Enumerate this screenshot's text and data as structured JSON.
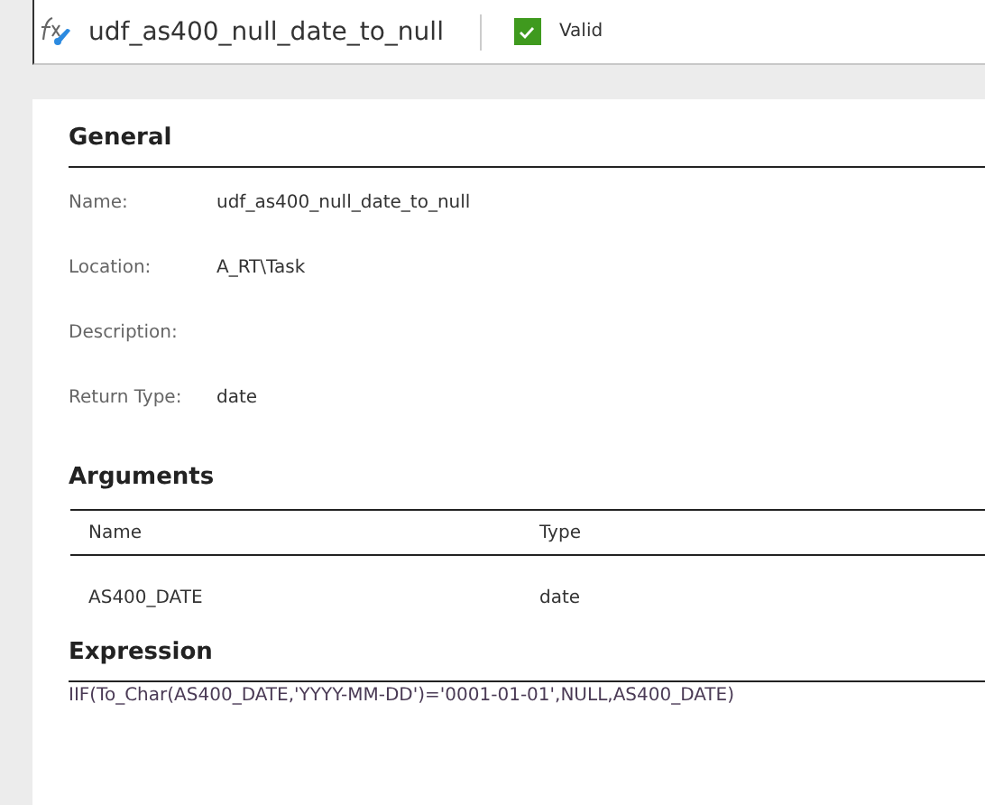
{
  "header": {
    "title": "udf_as400_null_date_to_null",
    "valid": true,
    "valid_label": "Valid"
  },
  "general": {
    "heading": "General",
    "fields": [
      {
        "label": "Name:",
        "value": "udf_as400_null_date_to_null"
      },
      {
        "label": "Location:",
        "value": "A_RT\\Task"
      },
      {
        "label": "Description:"
      },
      {
        "label": "Return Type:",
        "value": "date"
      }
    ]
  },
  "arguments": {
    "heading": "Arguments",
    "columns": [
      "Name",
      "Type"
    ],
    "rows": [
      [
        "AS400_DATE",
        "date"
      ]
    ]
  },
  "expression": {
    "heading": "Expression",
    "text": "IIF(To_Char(AS400_DATE,'YYYY-MM-DD')='0001-01-01',NULL,AS400_DATE)"
  }
}
